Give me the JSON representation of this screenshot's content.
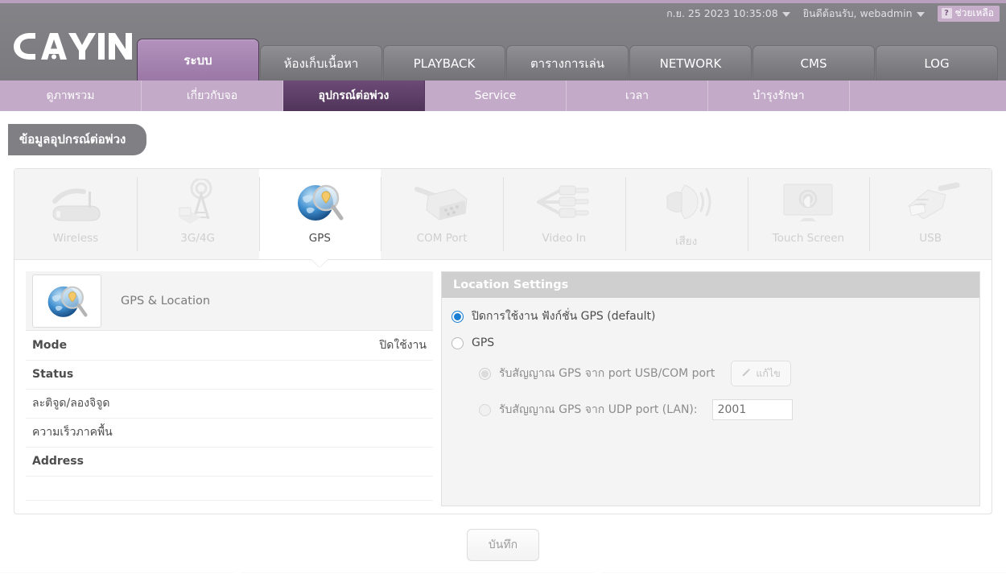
{
  "header": {
    "logo_text": "CAYIN",
    "datetime": "ก.ย. 25 2023 10:35:08",
    "welcome": "ยินดีต้อนรับ, webadmin",
    "help_label": "ช่วยเหลือ",
    "help_mark": "?",
    "main_tabs": [
      {
        "label": "ระบบ",
        "active": true
      },
      {
        "label": "ห้องเก็บเนื้อหา",
        "active": false
      },
      {
        "label": "PLAYBACK",
        "active": false
      },
      {
        "label": "ตารางการเล่น",
        "active": false
      },
      {
        "label": "NETWORK",
        "active": false
      },
      {
        "label": "CMS",
        "active": false
      },
      {
        "label": "LOG",
        "active": false
      }
    ],
    "sub_tabs": [
      {
        "label": "ดูภาพรวม",
        "active": false
      },
      {
        "label": "เกี่ยวกับจอ",
        "active": false
      },
      {
        "label": "อุปกรณ์ต่อพ่วง",
        "active": true
      },
      {
        "label": "Service",
        "active": false
      },
      {
        "label": "เวลา",
        "active": false
      },
      {
        "label": "บำรุงรักษา",
        "active": false
      }
    ]
  },
  "page": {
    "title": "ข้อมูลอุปกรณ์ต่อพ่วง"
  },
  "device_tabs": [
    {
      "label": "Wireless",
      "icon": "wireless-router-icon",
      "active": false
    },
    {
      "label": "3G/4G",
      "icon": "cell-tower-icon",
      "active": false
    },
    {
      "label": "GPS",
      "icon": "gps-globe-icon",
      "active": true
    },
    {
      "label": "COM Port",
      "icon": "serial-connector-icon",
      "active": false
    },
    {
      "label": "Video In",
      "icon": "rca-cables-icon",
      "active": false
    },
    {
      "label": "เสียง",
      "icon": "speaker-icon",
      "active": false
    },
    {
      "label": "Touch Screen",
      "icon": "touch-screen-icon",
      "active": false
    },
    {
      "label": "USB",
      "icon": "usb-plug-icon",
      "active": false
    }
  ],
  "info_panel": {
    "heading": "GPS & Location",
    "icon": "gps-globe-icon",
    "rows": [
      {
        "key": "Mode",
        "value": "ปิดใช้งาน",
        "bold": true
      },
      {
        "key": "Status",
        "value": "",
        "bold": true
      },
      {
        "key": "ละติจูด/ลองจิจูด",
        "value": "",
        "bold": false
      },
      {
        "key": "ความเร็วภาคพื้น",
        "value": "",
        "bold": false
      },
      {
        "key": "Address",
        "value": "",
        "bold": true
      }
    ]
  },
  "settings_panel": {
    "title": "Location Settings",
    "options": [
      {
        "label": "ปิดการใช้งาน ฟังก์ชั่น GPS (default)",
        "state": "checked",
        "indent": false
      },
      {
        "label": "GPS",
        "state": "unchecked",
        "indent": false
      },
      {
        "label": "รับสัญญาณ GPS จาก port USB/COM port",
        "state": "disabled-semi",
        "indent": true,
        "button": {
          "label": "แก้ไข",
          "icon": "pencil-icon"
        }
      },
      {
        "label": "รับสัญญาณ GPS จาก UDP port (LAN):",
        "state": "disabled",
        "indent": true,
        "input": {
          "value": "2001",
          "placeholder": ""
        }
      }
    ]
  },
  "footer": {
    "save_label": "บันทึก"
  }
}
